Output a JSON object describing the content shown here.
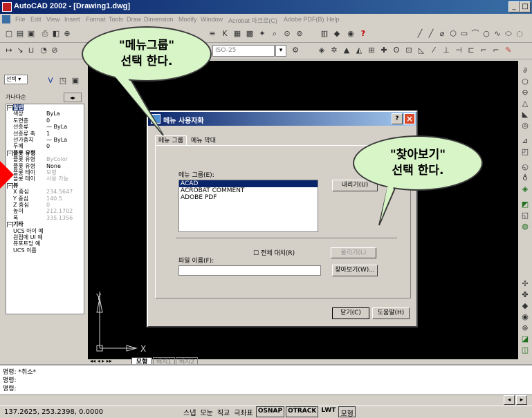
{
  "window": {
    "title": "AutoCAD 2002 - [Drawing1.dwg]"
  },
  "menu": [
    "File",
    "Edit",
    "View",
    "Insert",
    "Format",
    "Tools",
    "Draw",
    "Dimension",
    "Modify",
    "Window",
    "Acrobat 아크로(C)",
    "Adobe PDF(B)",
    "Help"
  ],
  "toolbar": {
    "dimstyle": "ISO-25"
  },
  "left_panel": {
    "selector": "선택",
    "tab_label": "가나다순",
    "categories": [
      {
        "label": "일반",
        "rows": [
          {
            "key": "색상",
            "value": "ByLa",
            "gray": false
          },
          {
            "key": "도면층",
            "value": "0",
            "gray": false
          },
          {
            "key": "선종류",
            "value": "— ByLa",
            "gray": false
          },
          {
            "key": "선종류 축",
            "value": "1",
            "gray": false
          },
          {
            "key": "선가중치",
            "value": "— ByLa",
            "gray": false
          },
          {
            "key": "두께",
            "value": "0",
            "gray": false
          }
        ]
      },
      {
        "label": "플롯 유형",
        "rows": [
          {
            "key": "플롯 유형",
            "value": "ByColor",
            "gray": true
          },
          {
            "key": "플롯 유형",
            "value": "None",
            "gray": false
          },
          {
            "key": "플롯 테이",
            "value": "모형",
            "gray": true
          },
          {
            "key": "플롯 테이",
            "value": "사용 가능",
            "gray": true
          }
        ]
      },
      {
        "label": "뷰",
        "rows": [
          {
            "key": "X 중심",
            "value": "234.5647",
            "gray": true
          },
          {
            "key": "Y 중심",
            "value": "140.5",
            "gray": true
          },
          {
            "key": "Z 중심",
            "value": "0",
            "gray": true
          },
          {
            "key": "높이",
            "value": "212.1702",
            "gray": true
          },
          {
            "key": "폭",
            "value": "335.1356",
            "gray": true
          }
        ]
      },
      {
        "label": "기타",
        "rows": [
          {
            "key": "UCS 아이 예",
            "value": "",
            "gray": false
          },
          {
            "key": "원점에 UI 예",
            "value": "",
            "gray": false
          },
          {
            "key": "뷰포트당 예",
            "value": "",
            "gray": false
          },
          {
            "key": "UCS 이름",
            "value": "",
            "gray": false
          }
        ]
      }
    ]
  },
  "layout_tabs": [
    "모형",
    "배치1",
    "배치2"
  ],
  "dialog": {
    "title": "메뉴 사용자화",
    "help_btn": "?",
    "close_btn": "×",
    "tabs": [
      "메뉴 그룹",
      "메뉴 막대"
    ],
    "group_label": "메뉴 그룹(E):",
    "groups": [
      "ACAD",
      "ACROBAT COMMENT",
      "ADOBE PDF"
    ],
    "unload_btn": "내리기(U)",
    "replace_all": "전체 대치(R)",
    "load_btn": "올리기(L)",
    "file_label": "파일 이름(F):",
    "browse_btn": "찾아보기(W)...",
    "close_dlg_btn": "닫기(C)",
    "help_dlg_btn": "도움말(H)"
  },
  "callouts": {
    "left": {
      "line1": "\"메뉴그룹\"",
      "line2": "선택 한다."
    },
    "right": {
      "line1": "\"찾아보기\"",
      "line2": "선택 한다."
    }
  },
  "command": {
    "line1": "명령: *취소*",
    "prompt1": "명령:",
    "prompt2": "명령:"
  },
  "status": {
    "coords": "137.2625, 253.2398, 0.0000",
    "toggles": [
      "스냅",
      "모눈",
      "직교",
      "극좌표",
      "OSNAP",
      "OTRACK",
      "LWT",
      "모형"
    ]
  },
  "colors": {
    "accent": "#0a246a",
    "canvas": "#000000",
    "callout_fill": "#d8f5c8",
    "arrow": "#ff0000"
  }
}
